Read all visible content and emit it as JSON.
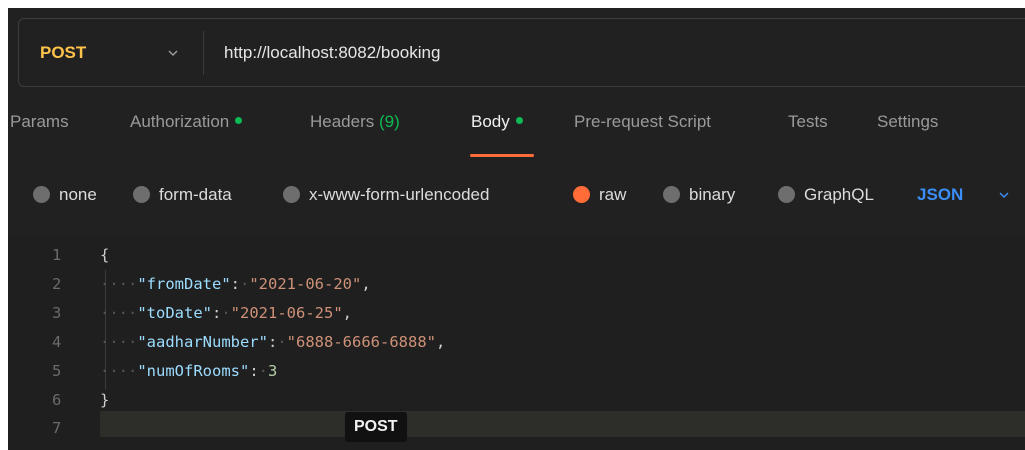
{
  "request": {
    "method": "POST",
    "url": "http://localhost:8082/booking"
  },
  "tabs": [
    {
      "label": "Params"
    },
    {
      "label": "Authorization"
    },
    {
      "label": "Headers",
      "count": "(9)"
    },
    {
      "label": "Body"
    },
    {
      "label": "Pre-request Script"
    },
    {
      "label": "Tests"
    },
    {
      "label": "Settings"
    }
  ],
  "body_types": [
    {
      "label": "none"
    },
    {
      "label": "form-data"
    },
    {
      "label": "x-www-form-urlencoded"
    },
    {
      "label": "raw",
      "selected": true
    },
    {
      "label": "binary"
    },
    {
      "label": "GraphQL"
    }
  ],
  "raw_language": "JSON",
  "editor": {
    "line_numbers": [
      "1",
      "2",
      "3",
      "4",
      "5",
      "6",
      "7"
    ],
    "open_brace": "{",
    "close_brace": "}",
    "fields": [
      {
        "key": "\"fromDate\"",
        "value": "\"2021-06-20\"",
        "comma": ","
      },
      {
        "key": "\"toDate\"",
        "value": "\"2021-06-25\"",
        "comma": ","
      },
      {
        "key": "\"aadharNumber\"",
        "value": "\"6888-6666-6888\"",
        "comma": ","
      },
      {
        "key": "\"numOfRooms\"",
        "value": "3",
        "comma": ""
      }
    ]
  },
  "tooltip": "POST",
  "colors": {
    "method": "#ffc24b",
    "accent": "#ff6c37",
    "status_dot": "#0cbb52",
    "language": "#3a8ef6",
    "json_key": "#9cdcfe",
    "json_string": "#ce9178",
    "json_number": "#b5cea8"
  }
}
